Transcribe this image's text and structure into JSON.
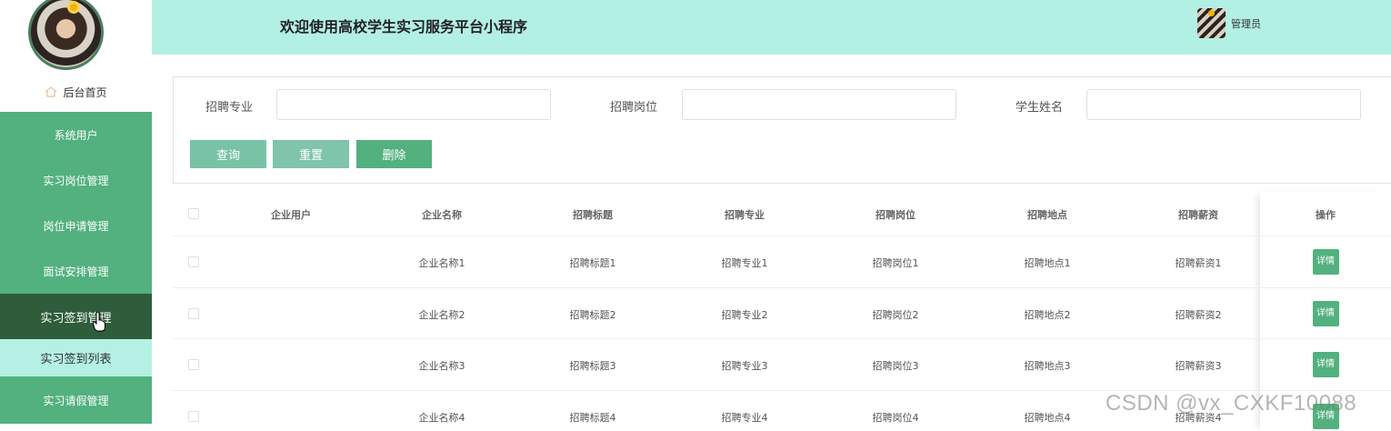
{
  "header": {
    "title": "欢迎使用高校学生实习服务平台小程序",
    "admin_label": "管理员"
  },
  "sidebar": {
    "home_label": "后台首页",
    "items": [
      {
        "label": "系统用户"
      },
      {
        "label": "实习岗位管理"
      },
      {
        "label": "岗位申请管理"
      },
      {
        "label": "面试安排管理"
      },
      {
        "label": "实习签到管理",
        "active": true
      },
      {
        "label": "实习签到列表",
        "sub": true
      },
      {
        "label": "实习请假管理"
      }
    ]
  },
  "search": {
    "fields": [
      {
        "label": "招聘专业",
        "value": "",
        "placeholder": ""
      },
      {
        "label": "招聘岗位",
        "value": "",
        "placeholder": ""
      },
      {
        "label": "学生姓名",
        "value": "",
        "placeholder": ""
      }
    ],
    "query_label": "查询",
    "reset_label": "重置",
    "delete_label": "删除"
  },
  "table": {
    "columns": [
      "企业用户",
      "企业名称",
      "招聘标题",
      "招聘专业",
      "招聘岗位",
      "招聘地点",
      "招聘薪资",
      "操作"
    ],
    "rows": [
      {
        "user": "",
        "company": "企业名称1",
        "title": "招聘标题1",
        "major": "招聘专业1",
        "position": "招聘岗位1",
        "location": "招聘地点1",
        "salary": "招聘薪资1",
        "action": "详情"
      },
      {
        "user": "",
        "company": "企业名称2",
        "title": "招聘标题2",
        "major": "招聘专业2",
        "position": "招聘岗位2",
        "location": "招聘地点2",
        "salary": "招聘薪资2",
        "action": "详情"
      },
      {
        "user": "",
        "company": "企业名称3",
        "title": "招聘标题3",
        "major": "招聘专业3",
        "position": "招聘岗位3",
        "location": "招聘地点3",
        "salary": "招聘薪资3",
        "action": "详情"
      },
      {
        "user": "",
        "company": "企业名称4",
        "title": "招聘标题4",
        "major": "招聘专业4",
        "position": "招聘岗位4",
        "location": "招聘地点4",
        "salary": "招聘薪资4",
        "action": "详情"
      }
    ]
  },
  "watermark": "CSDN @vx_CXKF10088",
  "colors": {
    "menu": "#52b17e",
    "menu_active": "#2f5d3b",
    "header": "#b3f0e4",
    "accent": "#52b17e"
  }
}
